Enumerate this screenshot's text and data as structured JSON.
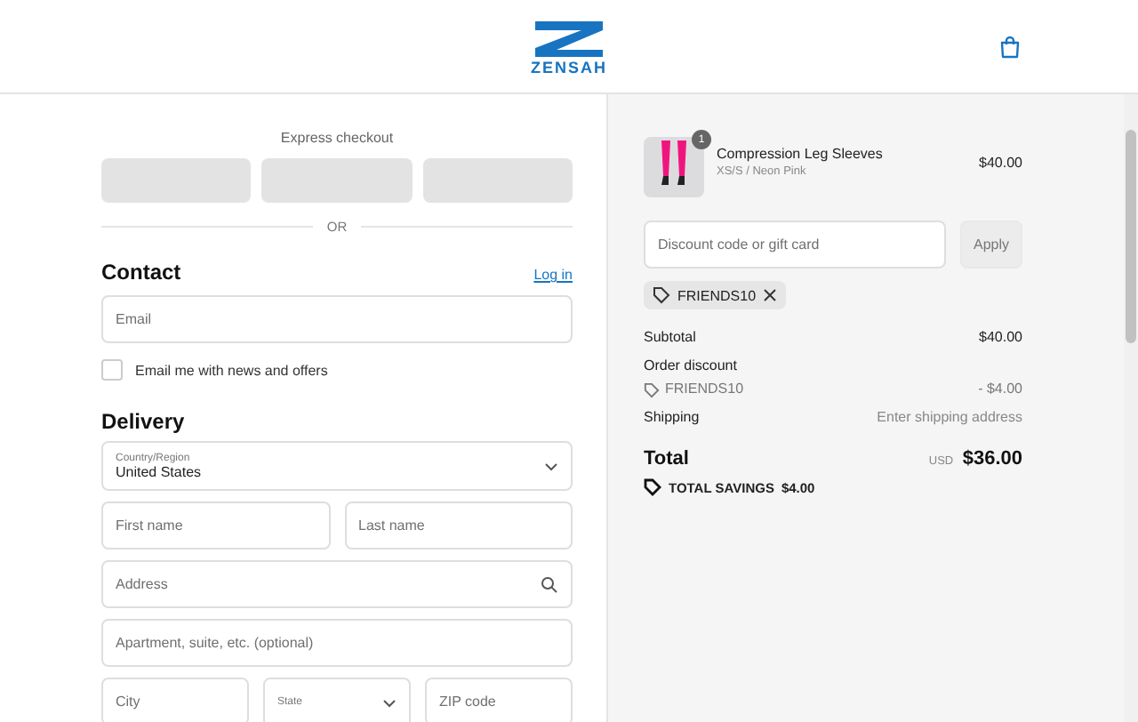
{
  "header": {
    "logo_text": "ZENSAH"
  },
  "express_checkout": {
    "title": "Express checkout",
    "divider_text": "OR"
  },
  "contact": {
    "heading": "Contact",
    "login_link": "Log in",
    "email": {
      "placeholder": "Email"
    },
    "newsletter": {
      "label": "Email me with news and offers",
      "checked": false
    }
  },
  "delivery": {
    "heading": "Delivery",
    "rows": [
      [
        {
          "kind": "select",
          "label": "Country/Region",
          "value": "United States"
        }
      ],
      [
        {
          "kind": "text",
          "placeholder": "First name"
        },
        {
          "kind": "text",
          "placeholder": "Last name"
        }
      ],
      [
        {
          "kind": "search",
          "placeholder": "Address"
        }
      ],
      [
        {
          "kind": "text",
          "placeholder": "Apartment, suite, etc. (optional)"
        }
      ],
      [
        {
          "kind": "text",
          "placeholder": "City"
        },
        {
          "kind": "select",
          "label": "State"
        },
        {
          "kind": "text",
          "placeholder": "ZIP code"
        }
      ]
    ]
  },
  "summary": {
    "item": {
      "name": "Compression Leg Sleeves",
      "variant": "XS/S / Neon Pink",
      "price": "$40.00",
      "quantity": "1"
    },
    "discount": {
      "placeholder": "Discount code or gift card",
      "button": "Apply"
    },
    "applied_code": "FRIENDS10",
    "lines": [
      {
        "kind": "line",
        "label": "Subtotal",
        "value": "$40.00"
      },
      {
        "kind": "heading",
        "label": "Order discount"
      },
      {
        "kind": "code",
        "label": "FRIENDS10",
        "value": "- $4.00"
      },
      {
        "kind": "muted",
        "label": "Shipping",
        "value": "Enter shipping address"
      }
    ],
    "total": {
      "label": "Total",
      "currency": "USD",
      "value": "$36.00"
    },
    "savings": {
      "label": "TOTAL SAVINGS",
      "value": "$4.00"
    }
  }
}
